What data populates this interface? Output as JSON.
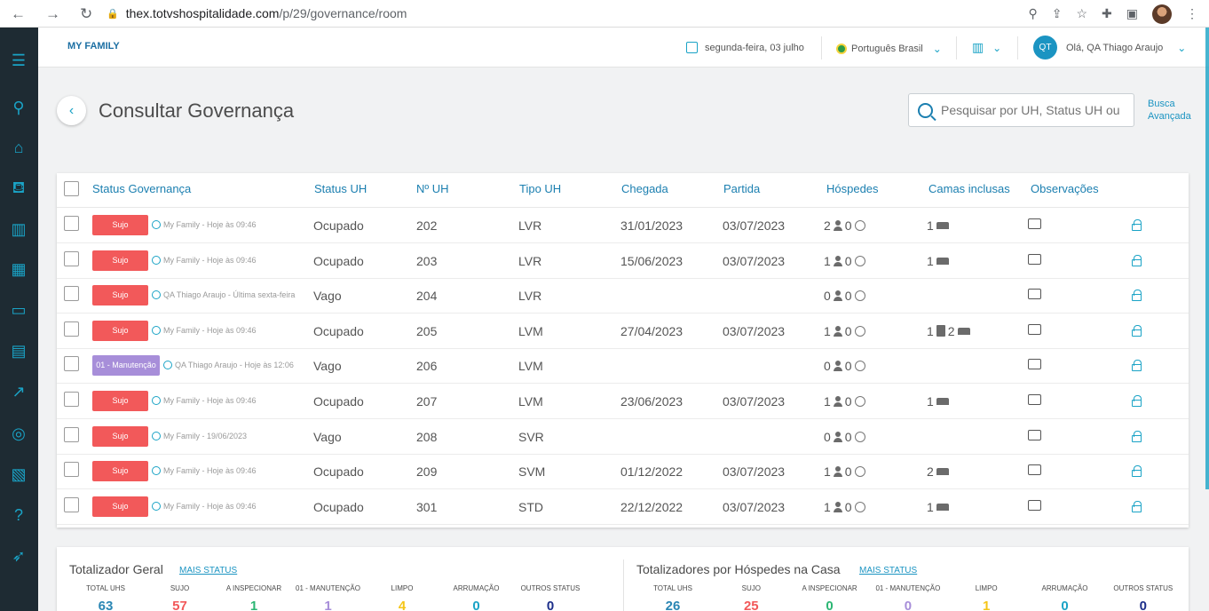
{
  "browser": {
    "url_host": "thex.totvshospitalidade.com",
    "url_path": "/p/29/governance/room"
  },
  "header": {
    "brand": "MY FAMILY",
    "date": "segunda-feira, 03 julho",
    "language": "Português Brasil",
    "user_initials": "QT",
    "user_greeting": "Olá, QA Thiago Araujo"
  },
  "page": {
    "title": "Consultar Governança",
    "search_placeholder": "Pesquisar por UH, Status UH ou",
    "advanced_search_line1": "Busca",
    "advanced_search_line2": "Avançada"
  },
  "table": {
    "columns": [
      "Status Governança",
      "Status UH",
      "Nº UH",
      "Tipo UH",
      "Chegada",
      "Partida",
      "Hóspedes",
      "Camas inclusas",
      "Observações"
    ],
    "rows": [
      {
        "status": "Sujo",
        "status_color": "red",
        "info": "My Family - Hoje às 09:46",
        "status_uh": "Ocupado",
        "uh": "202",
        "tipo": "LVR",
        "chegada": "31/01/2023",
        "partida": "03/07/2023",
        "adults": "2",
        "children": "0",
        "beds_single": "1",
        "beds_extra": ""
      },
      {
        "status": "Sujo",
        "status_color": "red",
        "info": "My Family - Hoje às 09:46",
        "status_uh": "Ocupado",
        "uh": "203",
        "tipo": "LVR",
        "chegada": "15/06/2023",
        "partida": "03/07/2023",
        "adults": "1",
        "children": "0",
        "beds_single": "1",
        "beds_extra": ""
      },
      {
        "status": "Sujo",
        "status_color": "red",
        "info": "QA Thiago Araujo - Última sexta-feira",
        "status_uh": "Vago",
        "uh": "204",
        "tipo": "LVR",
        "chegada": "",
        "partida": "",
        "adults": "0",
        "children": "0",
        "beds_single": "",
        "beds_extra": ""
      },
      {
        "status": "Sujo",
        "status_color": "red",
        "info": "My Family - Hoje às 09:46",
        "status_uh": "Ocupado",
        "uh": "205",
        "tipo": "LVM",
        "chegada": "27/04/2023",
        "partida": "03/07/2023",
        "adults": "1",
        "children": "0",
        "beds_single": "1",
        "beds_extra": "2"
      },
      {
        "status": "01 - Manutenção",
        "status_color": "purple",
        "info": "QA Thiago Araujo - Hoje às 12:06",
        "status_uh": "Vago",
        "uh": "206",
        "tipo": "LVM",
        "chegada": "",
        "partida": "",
        "adults": "0",
        "children": "0",
        "beds_single": "",
        "beds_extra": ""
      },
      {
        "status": "Sujo",
        "status_color": "red",
        "info": "My Family - Hoje às 09:46",
        "status_uh": "Ocupado",
        "uh": "207",
        "tipo": "LVM",
        "chegada": "23/06/2023",
        "partida": "03/07/2023",
        "adults": "1",
        "children": "0",
        "beds_single": "1",
        "beds_extra": ""
      },
      {
        "status": "Sujo",
        "status_color": "red",
        "info": "My Family - 19/06/2023",
        "status_uh": "Vago",
        "uh": "208",
        "tipo": "SVR",
        "chegada": "",
        "partida": "",
        "adults": "0",
        "children": "0",
        "beds_single": "",
        "beds_extra": ""
      },
      {
        "status": "Sujo",
        "status_color": "red",
        "info": "My Family - Hoje às 09:46",
        "status_uh": "Ocupado",
        "uh": "209",
        "tipo": "SVM",
        "chegada": "01/12/2022",
        "partida": "03/07/2023",
        "adults": "1",
        "children": "0",
        "beds_single": "2",
        "beds_extra": ""
      },
      {
        "status": "Sujo",
        "status_color": "red",
        "info": "My Family - Hoje às 09:46",
        "status_uh": "Ocupado",
        "uh": "301",
        "tipo": "STD",
        "chegada": "22/12/2022",
        "partida": "03/07/2023",
        "adults": "1",
        "children": "0",
        "beds_single": "1",
        "beds_extra": ""
      }
    ]
  },
  "totals": {
    "general": {
      "title": "Totalizador Geral",
      "more": "MAIS STATUS",
      "stats": [
        {
          "label": "TOTAL UHS",
          "value": "63",
          "color": "#2a86b4"
        },
        {
          "label": "SUJO",
          "value": "57",
          "color": "#f2595a"
        },
        {
          "label": "A INSPECIONAR",
          "value": "1",
          "color": "#2bb673"
        },
        {
          "label": "01 - MANUTENÇÃO",
          "value": "1",
          "color": "#a78ed9"
        },
        {
          "label": "LIMPO",
          "value": "4",
          "color": "#f5c518"
        },
        {
          "label": "ARRUMAÇÃO",
          "value": "0",
          "color": "#1aa3c6"
        },
        {
          "label": "OUTROS STATUS",
          "value": "0",
          "color": "#1c2e8a"
        }
      ]
    },
    "guests": {
      "title": "Totalizadores por Hóspedes na Casa",
      "more": "MAIS STATUS",
      "stats": [
        {
          "label": "TOTAL UHS",
          "value": "26",
          "color": "#2a86b4"
        },
        {
          "label": "SUJO",
          "value": "25",
          "color": "#f2595a"
        },
        {
          "label": "A INSPECIONAR",
          "value": "0",
          "color": "#2bb673"
        },
        {
          "label": "01 - MANUTENÇÃO",
          "value": "0",
          "color": "#a78ed9"
        },
        {
          "label": "LIMPO",
          "value": "1",
          "color": "#f5c518"
        },
        {
          "label": "ARRUMAÇÃO",
          "value": "0",
          "color": "#1aa3c6"
        },
        {
          "label": "OUTROS STATUS",
          "value": "0",
          "color": "#1c2e8a"
        }
      ]
    }
  }
}
